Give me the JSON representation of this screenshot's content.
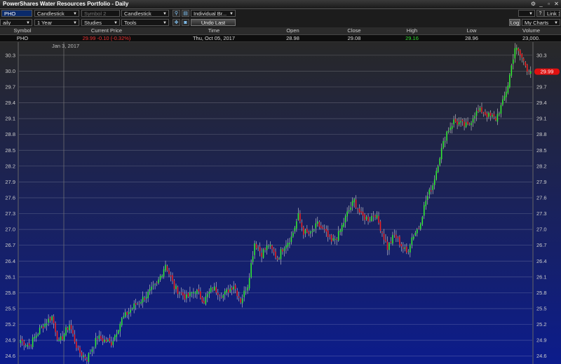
{
  "window": {
    "title": "PowerShares Water Resources Portfolio - Daily"
  },
  "toolbar1": {
    "symbol": "PHO",
    "chart_type": "Candlestick",
    "symbol2_placeholder": "Symbol 2",
    "chart_type2": "Candlestick",
    "layout": "Individual Br...",
    "link": "Link 1"
  },
  "toolbar2": {
    "interval": "aily",
    "range": "1 Year",
    "studies": "Studies",
    "tools": "Tools",
    "undo": "Undo Last",
    "log": "Log",
    "my_charts": "My Charts"
  },
  "quote": {
    "headers": [
      "Symbol",
      "Current Price",
      "Time",
      "Open",
      "Close",
      "High",
      "Low",
      "Volume"
    ],
    "symbol": "PHO",
    "price": "29.99",
    "change": "-0.10 (-0.32%)",
    "time": "Thu, Oct 05, 2017",
    "open": "28.98",
    "close": "29.08",
    "high": "29.16",
    "low": "28.96",
    "volume": "23,000."
  },
  "colors": {
    "up": "#33ee33",
    "down": "#ee2222",
    "bg_top": "#282828",
    "bg_bottom": "#0c1c8c",
    "price_tag": "#e01010"
  },
  "chart_data": {
    "type": "candlestick",
    "title": "",
    "xlabel": "",
    "ylabel": "",
    "date_marker": "Jan 3, 2017",
    "ylim": [
      24.45,
      30.55
    ],
    "yticks": [
      24.6,
      24.9,
      25.2,
      25.5,
      25.8,
      26.1,
      26.4,
      26.7,
      27.0,
      27.3,
      27.6,
      27.9,
      28.2,
      28.5,
      28.8,
      29.1,
      29.4,
      29.7,
      30.0,
      30.3
    ],
    "ytick_labels": [
      "24.6",
      "24.9",
      "25.2",
      "25.5",
      "25.8",
      "26.1",
      "26.4",
      "26.7",
      "27.0",
      "27.3",
      "27.6",
      "27.9",
      "28.2",
      "28.5",
      "28.8",
      "29.1",
      "29.4",
      "29.7",
      "30.0",
      "30.3"
    ],
    "last_price": 29.99,
    "last_price_label": "29.99",
    "anchors": [
      [
        0,
        24.9
      ],
      [
        5,
        24.8
      ],
      [
        12,
        25.15
      ],
      [
        18,
        25.35
      ],
      [
        22,
        24.85
      ],
      [
        28,
        25.2
      ],
      [
        33,
        24.7
      ],
      [
        38,
        24.55
      ],
      [
        44,
        24.95
      ],
      [
        52,
        24.85
      ],
      [
        58,
        25.3
      ],
      [
        65,
        25.55
      ],
      [
        72,
        25.75
      ],
      [
        78,
        25.95
      ],
      [
        83,
        26.35
      ],
      [
        88,
        25.9
      ],
      [
        95,
        25.7
      ],
      [
        100,
        25.85
      ],
      [
        105,
        25.65
      ],
      [
        110,
        25.9
      ],
      [
        116,
        25.75
      ],
      [
        122,
        25.95
      ],
      [
        126,
        25.65
      ],
      [
        130,
        25.95
      ],
      [
        134,
        26.75
      ],
      [
        138,
        26.55
      ],
      [
        142,
        26.7
      ],
      [
        147,
        26.45
      ],
      [
        151,
        26.7
      ],
      [
        155,
        26.85
      ],
      [
        159,
        27.25
      ],
      [
        162,
        26.95
      ],
      [
        166,
        26.9
      ],
      [
        170,
        27.1
      ],
      [
        174,
        26.95
      ],
      [
        178,
        26.75
      ],
      [
        182,
        26.9
      ],
      [
        187,
        27.3
      ],
      [
        191,
        27.55
      ],
      [
        195,
        27.25
      ],
      [
        199,
        27.2
      ],
      [
        203,
        27.3
      ],
      [
        207,
        26.95
      ],
      [
        210,
        26.65
      ],
      [
        214,
        26.9
      ],
      [
        218,
        26.7
      ],
      [
        221,
        26.55
      ],
      [
        224,
        26.85
      ],
      [
        228,
        27.05
      ],
      [
        232,
        27.55
      ],
      [
        236,
        27.85
      ],
      [
        240,
        28.4
      ],
      [
        244,
        28.85
      ],
      [
        248,
        29.05
      ],
      [
        252,
        29.0
      ],
      [
        256,
        28.95
      ],
      [
        260,
        29.2
      ],
      [
        264,
        29.25
      ],
      [
        268,
        29.15
      ],
      [
        272,
        29.1
      ],
      [
        276,
        29.4
      ],
      [
        279,
        29.75
      ],
      [
        283,
        30.45
      ],
      [
        287,
        30.25
      ],
      [
        290,
        30.05
      ],
      [
        292,
        29.99
      ]
    ]
  }
}
